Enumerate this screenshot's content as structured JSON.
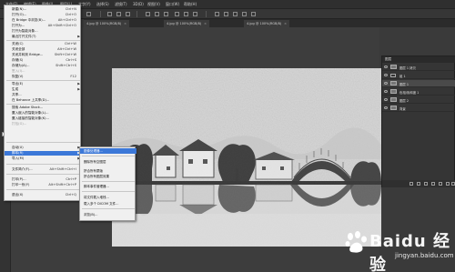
{
  "app": {
    "menubar": [
      "文件(F)",
      "编辑(E)",
      "图像(I)",
      "图层(L)",
      "文字(Y)",
      "选择(S)",
      "滤镜(T)",
      "3D(D)",
      "视图(V)",
      "窗口(W)",
      "帮助(H)"
    ]
  },
  "tabs": [
    {
      "label": "4.jpg @ 100%(RGB/8)"
    },
    {
      "label": "4.jpg @ 100%(RGB/8)"
    },
    {
      "label": "4.jpg @ 100%(RGB/8)"
    }
  ],
  "file_menu": {
    "items": [
      {
        "label": "新建(N)...",
        "shortcut": "Ctrl+N"
      },
      {
        "label": "打开(O)...",
        "shortcut": "Ctrl+O"
      },
      {
        "label": "在 Bridge 中浏览(B)...",
        "shortcut": "Alt+Ctrl+O"
      },
      {
        "label": "打开为...",
        "shortcut": "Alt+Shift+Ctrl+O"
      },
      {
        "label": "打开为智能对象...",
        "shortcut": ""
      },
      {
        "label": "最近打开文件(T)",
        "shortcut": ""
      },
      {
        "label": "关闭(C)",
        "shortcut": "Ctrl+W"
      },
      {
        "label": "关闭全部",
        "shortcut": "Alt+Ctrl+W"
      },
      {
        "label": "关闭并转到 Bridge...",
        "shortcut": "Shift+Ctrl+W"
      },
      {
        "label": "存储(S)",
        "shortcut": "Ctrl+S"
      },
      {
        "label": "存储为(A)...",
        "shortcut": "Shift+Ctrl+S"
      },
      {
        "label": "签入(I)...",
        "shortcut": ""
      },
      {
        "label": "恢复(V)",
        "shortcut": "F12"
      },
      {
        "label": "导出(E)",
        "shortcut": ""
      },
      {
        "label": "生成",
        "shortcut": ""
      },
      {
        "label": "共享...",
        "shortcut": ""
      },
      {
        "label": "在 Behance 上共享(D)...",
        "shortcut": ""
      },
      {
        "label": "搜索 Adobe Stock...",
        "shortcut": ""
      },
      {
        "label": "置入嵌入的智能对象(L)...",
        "shortcut": ""
      },
      {
        "label": "置入链接的智能对象(K)...",
        "shortcut": ""
      },
      {
        "label": "打包(G)...",
        "shortcut": ""
      },
      {
        "label": "自动(U)",
        "shortcut": ""
      },
      {
        "label": "脚本(R)",
        "shortcut": ""
      },
      {
        "label": "导入(M)",
        "shortcut": ""
      },
      {
        "label": "文件简介(F)...",
        "shortcut": "Alt+Shift+Ctrl+I"
      },
      {
        "label": "打印(P)...",
        "shortcut": "Ctrl+P"
      },
      {
        "label": "打印一份(Y)",
        "shortcut": "Alt+Shift+Ctrl+P"
      },
      {
        "label": "退出(X)",
        "shortcut": "Ctrl+Q"
      }
    ]
  },
  "scripts_submenu": {
    "items": [
      {
        "label": "图像处理器..."
      },
      {
        "label": "删除所有空图层"
      },
      {
        "label": "拼合所有蒙版"
      },
      {
        "label": "拼合所有图层效果"
      },
      {
        "label": "脚本事件管理器..."
      },
      {
        "label": "将文件载入堆栈..."
      },
      {
        "label": "载入多个 DICOM 文件..."
      },
      {
        "label": "浏览(B)..."
      }
    ]
  },
  "layers_panel": {
    "title": "图层",
    "layers": [
      {
        "name": "图层 1 拷贝"
      },
      {
        "name": "组 1"
      },
      {
        "name": "图层 1"
      },
      {
        "name": "色相/饱和度 1"
      },
      {
        "name": "图层 2"
      },
      {
        "name": "背景"
      }
    ]
  },
  "watermark": {
    "text": "Baidu 经验",
    "url": "jingyan.baidu.com"
  },
  "colors": {
    "menu_highlight": "#3c78d8",
    "workspace_bg": "#3a3a3a"
  }
}
